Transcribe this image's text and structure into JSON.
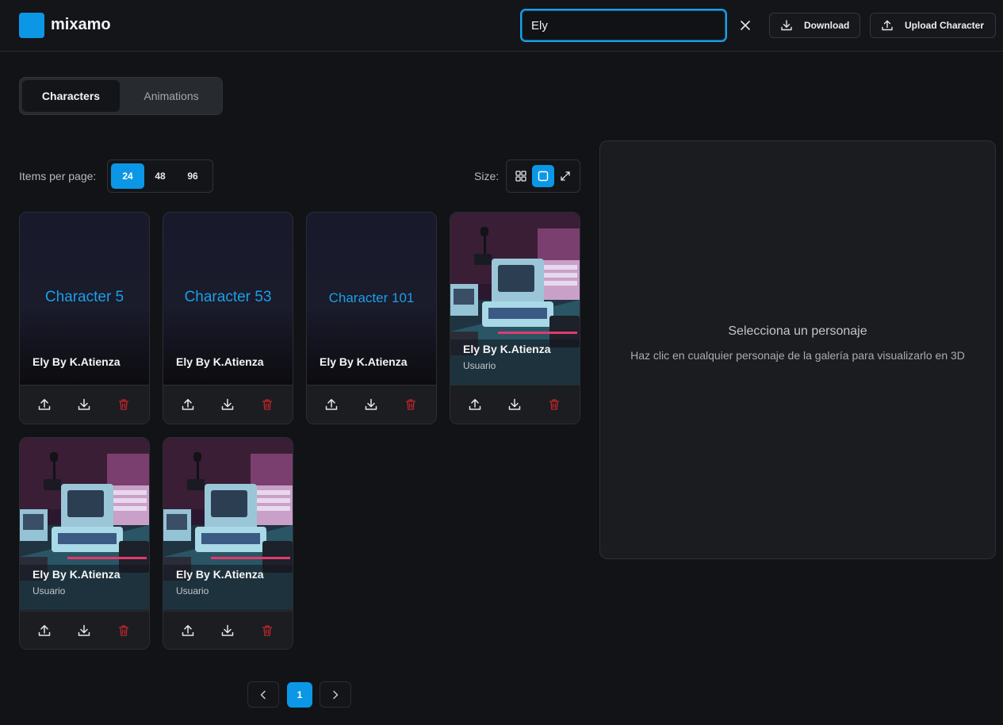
{
  "header": {
    "logo_text": "mixamo",
    "search_value": "Ely",
    "download_label": "Download",
    "upload_label": "Upload Character"
  },
  "tabs": [
    {
      "label": "Characters",
      "active": true
    },
    {
      "label": "Animations",
      "active": false
    }
  ],
  "toolbar": {
    "items_per_page_label": "Items per page:",
    "items_per_page_options": [
      "24",
      "48",
      "96"
    ],
    "items_per_page_selected": "24",
    "size_label": "Size:",
    "size_selected": "medium"
  },
  "cards": [
    {
      "placeholder": "Character 5",
      "name": "Ely By K.Atienza",
      "sub": "",
      "has_image": false
    },
    {
      "placeholder": "Character 53",
      "name": "Ely By K.Atienza",
      "sub": "",
      "has_image": false
    },
    {
      "placeholder": "Character 101",
      "name": "Ely By K.Atienza",
      "sub": "",
      "has_image": false
    },
    {
      "placeholder": "",
      "name": "Ely By K.Atienza",
      "sub": "Usuario",
      "has_image": true
    },
    {
      "placeholder": "",
      "name": "Ely By K.Atienza",
      "sub": "Usuario",
      "has_image": true
    },
    {
      "placeholder": "",
      "name": "Ely By K.Atienza",
      "sub": "Usuario",
      "has_image": true
    }
  ],
  "preview": {
    "title": "Selecciona un personaje",
    "description": "Haz clic en cualquier personaje de la galería para visualizarlo en 3D"
  },
  "pagination": {
    "current_page": "1"
  },
  "colors": {
    "accent": "#0b97e6",
    "background": "#121316",
    "delete": "#c0262b"
  }
}
